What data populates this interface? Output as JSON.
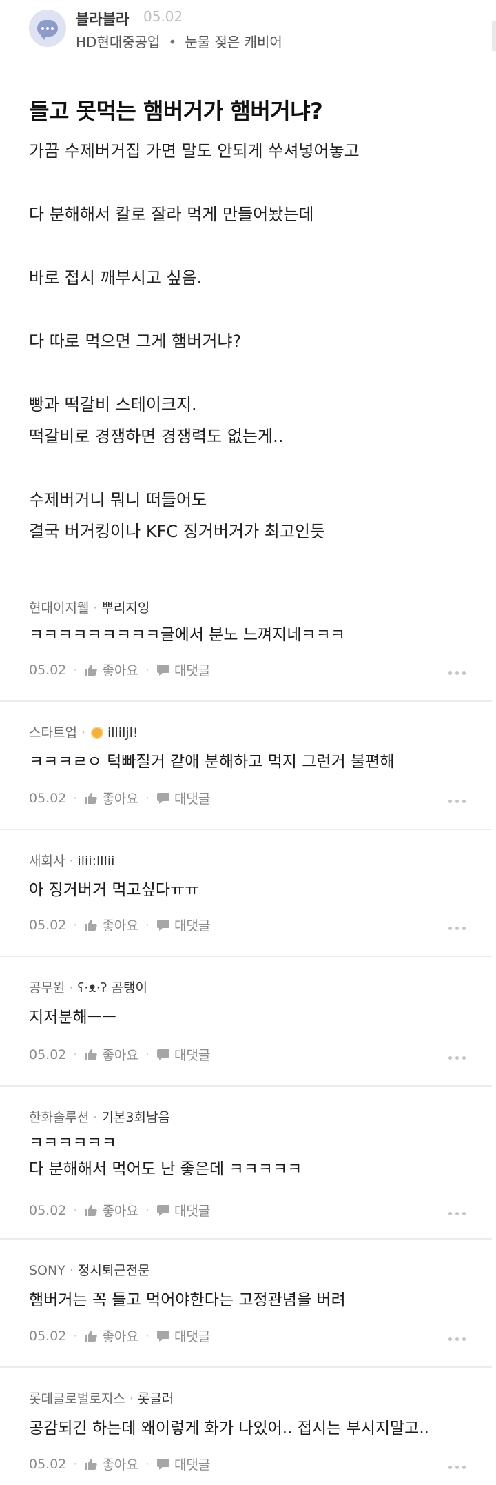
{
  "board": {
    "name": "블라블라",
    "date": "05.02",
    "company": "HD현대중공업",
    "separator": "•",
    "nickname": "눈물 젖은 캐비어"
  },
  "post": {
    "title": "들고 못먹는 햄버거가 햄버거냐?",
    "lines": [
      "가끔 수제버거집 가면 말도 안되게 쑤셔넣어놓고",
      "",
      "다 분해해서 칼로 잘라 먹게 만들어놨는데",
      "",
      "바로 접시 깨부시고 싶음.",
      "",
      "다 따로 먹으면 그게 햄버거냐?",
      "",
      "빵과 떡갈비 스테이크지.",
      "떡갈비로 경쟁하면 경쟁력도 없는게..",
      "",
      "수제버거니 뭐니 떠들어도",
      "결국 버거킹이나 KFC 징거버거가 최고인듯"
    ]
  },
  "comment_actions": {
    "like": "좋아요",
    "reply": "대댓글",
    "middot": "·"
  },
  "comments": [
    {
      "company": "현대이지웰",
      "nickname": "뿌리지잉",
      "badge": false,
      "lines": [
        "ㅋㅋㅋㅋㅋㅋㅋㅋㅋ글에서 분노 느껴지네ㅋㅋㅋ"
      ],
      "date": "05.02"
    },
    {
      "company": "스타트업",
      "nickname": "illiljl!",
      "badge": true,
      "lines": [
        "ㅋㅋㅋㄹㅇ 턱빠질거 같애 분해하고 먹지 그런거 불편해"
      ],
      "date": "05.02"
    },
    {
      "company": "새회사",
      "nickname": "ilii:lllii",
      "badge": false,
      "lines": [
        "아 징거버거 먹고싶다ㅠㅠ"
      ],
      "date": "05.02"
    },
    {
      "company": "공무원",
      "nickname": "ʕ·ᴥ·ʔ 곰탱이",
      "badge": false,
      "lines": [
        "지저분해ㅡㅡ"
      ],
      "date": "05.02"
    },
    {
      "company": "한화솔루션",
      "nickname": "기본3회남음",
      "badge": false,
      "lines": [
        "ㅋㅋㅋㅋㅋㅋ",
        "다 분해해서 먹어도 난 좋은데 ㅋㅋㅋㅋㅋ"
      ],
      "date": "05.02"
    },
    {
      "company": "SONY",
      "nickname": "정시퇴근전문",
      "badge": false,
      "lines": [
        "햄버거는 꼭 들고 먹어야한다는 고정관념을 버려"
      ],
      "date": "05.02"
    },
    {
      "company": "롯데글로벌로지스",
      "nickname": "롯글러",
      "badge": false,
      "lines": [
        "공감되긴 하는데 왜이렇게 화가 나있어.. 접시는 부시지말고.."
      ],
      "date": "05.02"
    }
  ]
}
